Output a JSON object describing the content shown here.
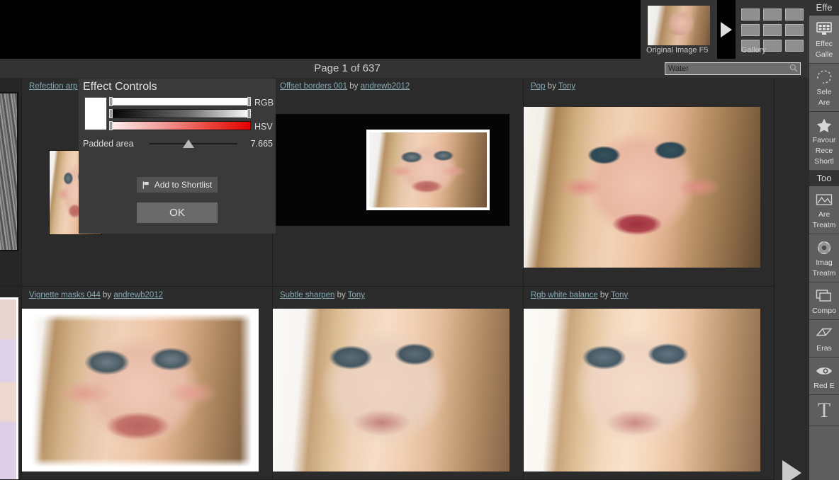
{
  "topbar": {
    "original_image": {
      "caption": "Original Image F5",
      "icon": "portrait-thumbnail"
    },
    "arrow_icon": "arrow-right-icon",
    "gallery": {
      "caption": "Gallery",
      "icon": "grid-icon",
      "cells": 9
    }
  },
  "header": {
    "page_label": "Page 1 of 637",
    "search": {
      "value": "Water",
      "placeholder": "Water",
      "icon": "search-icon"
    }
  },
  "effect_dialog": {
    "title": "Effect Controls",
    "swatch_color": "#ffffff",
    "sliders": [
      {
        "name": "RGB",
        "track": "rgb-white"
      },
      {
        "name": "",
        "track": "grayscale-ramp"
      },
      {
        "name": "HSV",
        "track": "red-saturation-ramp"
      }
    ],
    "parameter": {
      "label": "Padded area",
      "value": "7.665",
      "knob_pct": 38
    },
    "shortlist_button": {
      "label": "Add to Shortlist",
      "icon": "flag-icon"
    },
    "ok_button": {
      "label": "OK"
    }
  },
  "grid": {
    "rows": [
      {
        "cells": [
          {
            "kind": "partial-left",
            "title": null,
            "author": null,
            "style": "texture-gray"
          },
          {
            "kind": "full",
            "title": "Refection arp",
            "by": null,
            "author": null,
            "style": "face-warm"
          },
          {
            "kind": "full",
            "title": "Offset borders 001",
            "by": "by",
            "author": "andrewb2012",
            "style": "offset-borders"
          },
          {
            "kind": "full",
            "title": "Pop",
            "by": "by",
            "author": "Tony",
            "style": "pop"
          }
        ]
      },
      {
        "cells": [
          {
            "kind": "partial-left",
            "title": null,
            "author": null,
            "style": "texture-pastel"
          },
          {
            "kind": "full",
            "title": "Vignette masks 044",
            "by": "by",
            "author": "andrewb2012",
            "style": "vignette"
          },
          {
            "kind": "full",
            "title": "Subtle sharpen",
            "by": "by",
            "author": "Tony",
            "style": "face-sharp"
          },
          {
            "kind": "full",
            "title": "Rgb white balance",
            "by": "by",
            "author": "Tony",
            "style": "face-warm"
          }
        ]
      }
    ],
    "next_page_arrow": "play-arrow-icon"
  },
  "sidebar": {
    "header_effects": "Effe",
    "header_tools": "Too",
    "items": [
      {
        "id": "effects-gallery",
        "icon": "monitor-gallery-icon",
        "label_line1": "Effec",
        "label_line2": "Galle",
        "active": true
      },
      {
        "id": "selected-area",
        "icon": "dashed-lasso-icon",
        "label_line1": "Sele",
        "label_line2": "Are",
        "active": false
      },
      {
        "id": "favourites",
        "icon": "star-icon",
        "label_line1": "Favour",
        "label_line2": "Rece",
        "label_line3": "Shortl",
        "active": false
      },
      {
        "id": "area-treatments",
        "icon": "mountain-frame-icon",
        "label_line1": "Are",
        "label_line2": "Treatm",
        "active": false
      },
      {
        "id": "image-treatments",
        "icon": "aperture-icon",
        "label_line1": "Imag",
        "label_line2": "Treatm",
        "active": false
      },
      {
        "id": "compositing",
        "icon": "layers-icon",
        "label_line1": "Compo",
        "label_line2": "",
        "active": false
      },
      {
        "id": "eraser",
        "icon": "eraser-icon",
        "label_line1": "Eras",
        "label_line2": "",
        "active": false
      },
      {
        "id": "red-eye",
        "icon": "eye-icon",
        "label_line1": "Red E",
        "label_line2": "",
        "active": false
      },
      {
        "id": "text-tool",
        "icon": "text-T-icon",
        "label_line1": "T",
        "label_line2": "",
        "active": false
      }
    ]
  }
}
